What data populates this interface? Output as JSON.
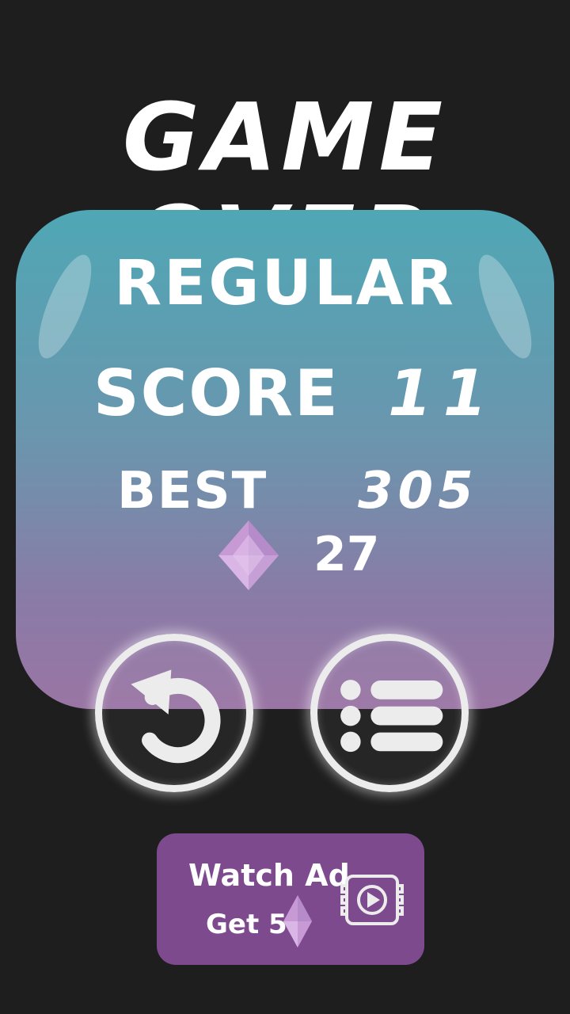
{
  "header": {
    "title": "GAME OVER"
  },
  "panel": {
    "mode_label": "REGULAR",
    "score_label": "SCORE",
    "score_value": "11",
    "best_label": "BEST",
    "best_value": "305",
    "gem_count": "27"
  },
  "buttons": {
    "restart_icon": "restart-icon",
    "menu_icon": "list-menu-icon"
  },
  "ad_button": {
    "line1": "Watch Ad",
    "line2": "Get 5",
    "icon": "video-play-icon"
  },
  "colors": {
    "background": "#1e1e1f",
    "panel_top": "#4fa7b5",
    "panel_bottom": "#9a75a4",
    "ad_button": "#7d4a8e",
    "gem": "#c8a3d6"
  }
}
